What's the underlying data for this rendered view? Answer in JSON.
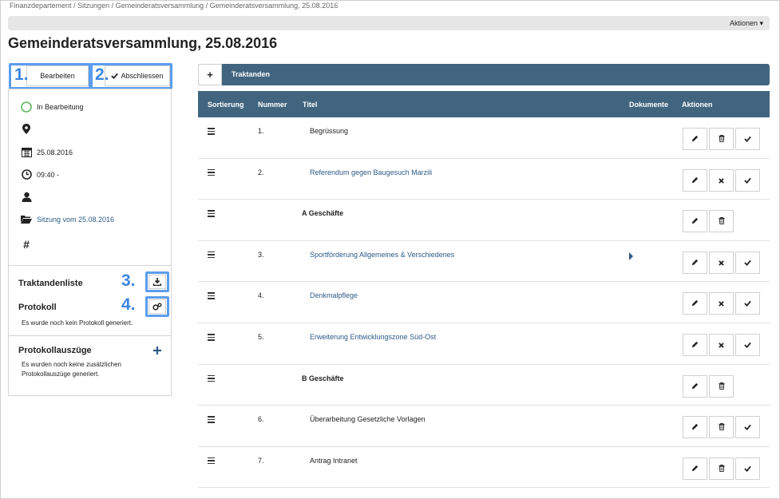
{
  "breadcrumb": "Finanzdepartement / Sitzungen / Gemeinderatsversammlung / Gemeinderatsversammlung, 25.08.2016",
  "toolbar": {
    "actions_label": "Aktionen ▾"
  },
  "page_title": "Gemeinderatsversammlung, 25.08.2016",
  "annotations": {
    "n1": "1.",
    "n2": "2.",
    "n3": "3.",
    "n4": "4."
  },
  "buttons": {
    "edit": "Bearbeiten",
    "close": "Abschliessen"
  },
  "meta": {
    "status": "In Bearbeitung",
    "date": "25.08.2016",
    "time": "09:40 -",
    "folder_link": "Sitzung vom 25.08.2016"
  },
  "sections": {
    "agenda_list": "Traktandenliste",
    "protocol_title": "Protokoll",
    "protocol_text": "Es wurde noch kein Protokoll generiert.",
    "excerpts_title": "Protokollauszüge",
    "excerpts_text_1": "Es wurden noch keine zusätzlichen",
    "excerpts_text_2": "Protokollauszüge generiert."
  },
  "tabs": {
    "plus": "+",
    "agenda": "Traktanden"
  },
  "table": {
    "headers": {
      "sort": "Sortierung",
      "number": "Nummer",
      "title": "Titel",
      "docs": "Dokumente",
      "actions": "Aktionen"
    },
    "rows": [
      {
        "number": "1.",
        "title": "Begrüssung",
        "kind": "item",
        "second": "trash",
        "link": false,
        "doc": false
      },
      {
        "number": "2.",
        "title": "Referendum gegen Baugesuch Marzili",
        "kind": "item",
        "second": "x",
        "link": true,
        "doc": false
      },
      {
        "number": "",
        "title": "A Geschäfte",
        "kind": "heading",
        "second": "trash",
        "link": false,
        "doc": false
      },
      {
        "number": "3.",
        "title": "Sportförderung Allgemeines & Verschiedenes",
        "kind": "item",
        "second": "x",
        "link": true,
        "doc": true
      },
      {
        "number": "4.",
        "title": "Denkmalpflege",
        "kind": "item",
        "second": "x",
        "link": true,
        "doc": false
      },
      {
        "number": "5.",
        "title": "Erweiterung Entwicklungszone Süd-Ost",
        "kind": "item",
        "second": "x",
        "link": true,
        "doc": false
      },
      {
        "number": "",
        "title": "B Geschäfte",
        "kind": "heading",
        "second": "trash",
        "link": false,
        "doc": false
      },
      {
        "number": "6.",
        "title": "Überarbeitung Gesetzliche Vorlagen",
        "kind": "item",
        "second": "trash",
        "link": false,
        "doc": false
      },
      {
        "number": "7.",
        "title": "Antrag Intranet",
        "kind": "item",
        "second": "trash",
        "link": false,
        "doc": false
      }
    ]
  },
  "colors": {
    "header_bg": "#41657f",
    "link": "#2c5a86",
    "annotation": "#3d86df",
    "status_ring": "#5cb85c"
  }
}
